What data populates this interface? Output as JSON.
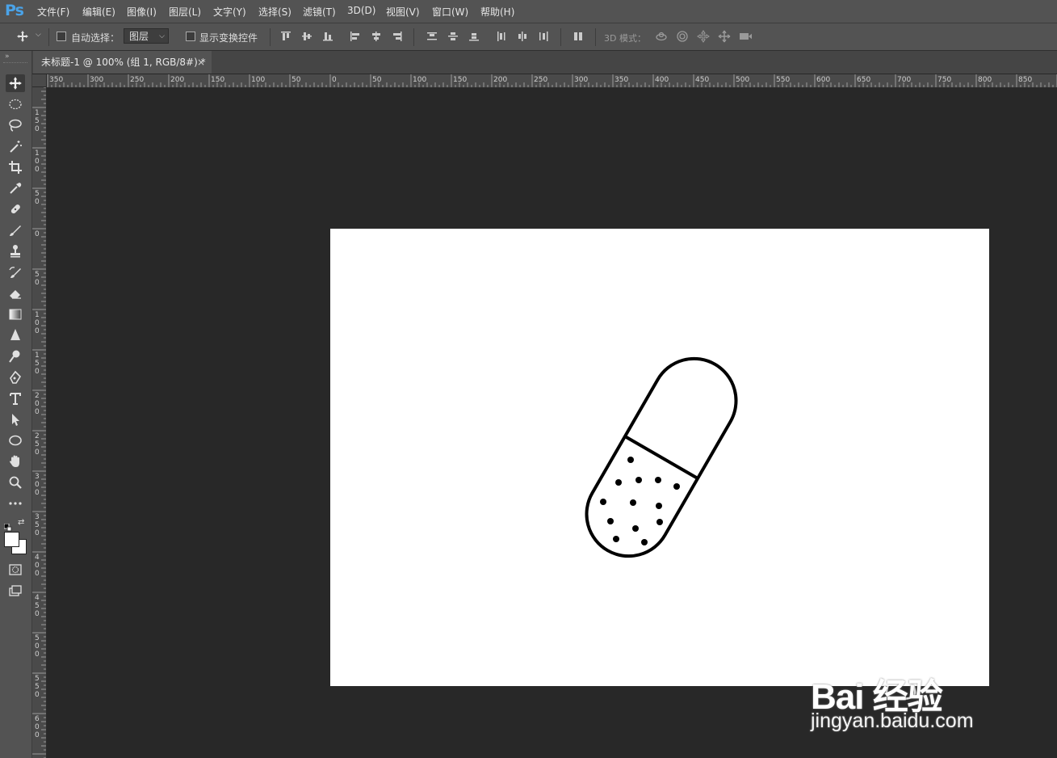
{
  "app": {
    "logo": "Ps"
  },
  "menu": [
    {
      "label": "文件(F)"
    },
    {
      "label": "编辑(E)"
    },
    {
      "label": "图像(I)"
    },
    {
      "label": "图层(L)"
    },
    {
      "label": "文字(Y)"
    },
    {
      "label": "选择(S)"
    },
    {
      "label": "滤镜(T)"
    },
    {
      "label": "3D(D)"
    },
    {
      "label": "视图(V)"
    },
    {
      "label": "窗口(W)"
    },
    {
      "label": "帮助(H)"
    }
  ],
  "options": {
    "auto_select_label": "自动选择：",
    "auto_select_value": "图层",
    "show_transform_label": "显示变换控件",
    "mode3d_label": "3D 模式："
  },
  "document": {
    "tab_title": "未标题-1 @ 100% (组 1, RGB/8#) *",
    "close_glyph": "×"
  },
  "ruler": {
    "h_labels": [
      "350",
      "300",
      "250",
      "200",
      "150",
      "100",
      "50",
      "0",
      "50",
      "100",
      "150",
      "200",
      "250",
      "300",
      "350",
      "400",
      "450",
      "500",
      "550",
      "600",
      "650",
      "700",
      "750",
      "800",
      "850"
    ],
    "v_labels": [
      "150",
      "100",
      "50",
      "0",
      "50",
      "100",
      "150",
      "200",
      "250",
      "300",
      "350",
      "400",
      "450",
      "500",
      "550",
      "600"
    ]
  },
  "watermark": {
    "brand": "Bai 经验",
    "url": "jingyan.baidu.com"
  },
  "colors": {
    "ui_bg": "#535353",
    "canvas_bg": "#282828",
    "accent": "#4aa3e8"
  }
}
